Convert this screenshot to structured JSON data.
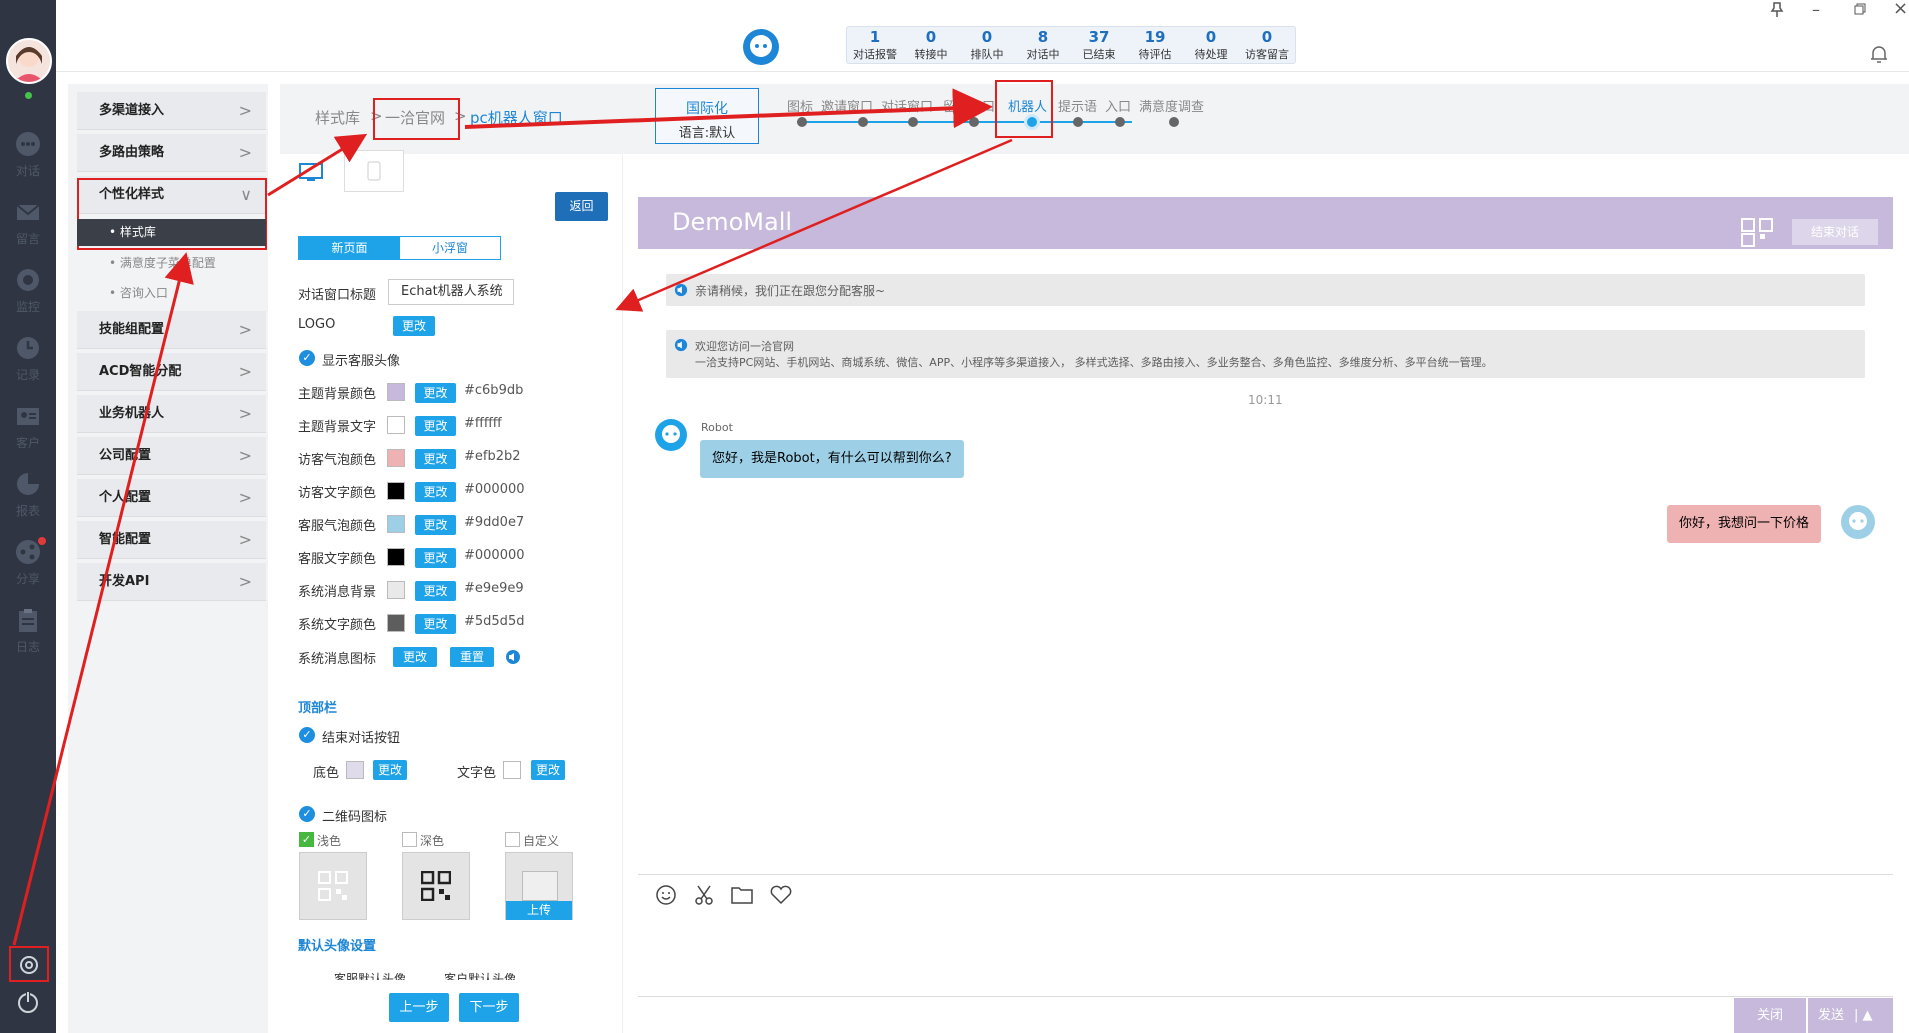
{
  "rail": {
    "items": [
      {
        "label": "对话",
        "icon": "chat-icon"
      },
      {
        "label": "留言",
        "icon": "mail-icon"
      },
      {
        "label": "监控",
        "icon": "eye-icon"
      },
      {
        "label": "记录",
        "icon": "clock-icon"
      },
      {
        "label": "客户",
        "icon": "contact-card-icon"
      },
      {
        "label": "报表",
        "icon": "pie-chart-icon"
      },
      {
        "label": "分享",
        "icon": "share-icon"
      },
      {
        "label": "日志",
        "icon": "clipboard-icon"
      }
    ]
  },
  "stats": [
    {
      "value": "1",
      "label": "对话报警"
    },
    {
      "value": "0",
      "label": "转接中"
    },
    {
      "value": "0",
      "label": "排队中"
    },
    {
      "value": "8",
      "label": "对话中"
    },
    {
      "value": "37",
      "label": "已结束"
    },
    {
      "value": "19",
      "label": "待评估"
    },
    {
      "value": "0",
      "label": "待处理"
    },
    {
      "value": "0",
      "label": "访客留言"
    }
  ],
  "nav": {
    "items": [
      "多渠道接入",
      "多路由策略",
      "个性化样式",
      "技能组配置",
      "ACD智能分配",
      "业务机器人",
      "公司配置",
      "个人配置",
      "智能配置",
      "开发API"
    ],
    "subitems": [
      "样式库",
      "满意度子菜单配置",
      "咨询入口"
    ]
  },
  "crumbs": {
    "c1": "样式库",
    "c2": "一洽官网",
    "c3": "pc机器人窗口"
  },
  "config": {
    "back": "返回",
    "tab_new": "新页面",
    "tab_float": "小浮窗",
    "title_label": "对话窗口标题",
    "title_value": "Echat机器人系统",
    "logo_label": "LOGO",
    "change": "更改",
    "reset": "重置",
    "show_avatar": "显示客服头像",
    "colors": [
      {
        "label": "主题背景颜色",
        "hex": "#c6b9db",
        "color": "#c6b9db"
      },
      {
        "label": "主题背景文字",
        "hex": "#ffffff",
        "color": "#ffffff"
      },
      {
        "label": "访客气泡颜色",
        "hex": "#efb2b2",
        "color": "#efb2b2"
      },
      {
        "label": "访客文字颜色",
        "hex": "#000000",
        "color": "#000000"
      },
      {
        "label": "客服气泡颜色",
        "hex": "#9dd0e7",
        "color": "#9dd0e7"
      },
      {
        "label": "客服文字颜色",
        "hex": "#000000",
        "color": "#000000"
      },
      {
        "label": "系统消息背景",
        "hex": "#e9e9e9",
        "color": "#e9e9e9"
      },
      {
        "label": "系统文字颜色",
        "hex": "#5d5d5d",
        "color": "#5d5d5d"
      }
    ],
    "sys_icon_label": "系统消息图标",
    "topbar_section": "顶部栏",
    "end_btn_check": "结束对话按钮",
    "bg_color": "底色",
    "text_color": "文字色",
    "qr_check": "二维码图标",
    "qr_light": "浅色",
    "qr_dark": "深色",
    "qr_custom": "自定义",
    "upload": "上传",
    "avatar_section": "默认头像设置",
    "avatar_sub": "客服默认头像          客户默认头像",
    "prev": "上一步",
    "next": "下一步"
  },
  "steps": {
    "intl": "国际化",
    "lang": "语言:默认",
    "labels": [
      "图标",
      "邀请窗口",
      "对话窗口",
      "留言窗口",
      "机器人",
      "提示语",
      "入口",
      "满意度调查"
    ]
  },
  "preview": {
    "brand": "DemoMall",
    "end_chat": "结束对话",
    "sys1": "亲请稍候，我们正在跟您分配客服~",
    "sys2_title": "欢迎您访问一洽官网",
    "sys2_body": "一洽支持PC网站、手机网站、商城系统、微信、APP、小程序等多渠道接入， 多样式选择、多路由接入、多业务整合、多角色监控、多维度分析、多平台统一管理。",
    "time": "10:11",
    "robot_name": "Robot",
    "robot_msg": "您好，我是Robot，有什么可以帮到你么?",
    "visitor_msg": "你好，我想问一下价格",
    "close": "关闭",
    "send": "发送"
  }
}
